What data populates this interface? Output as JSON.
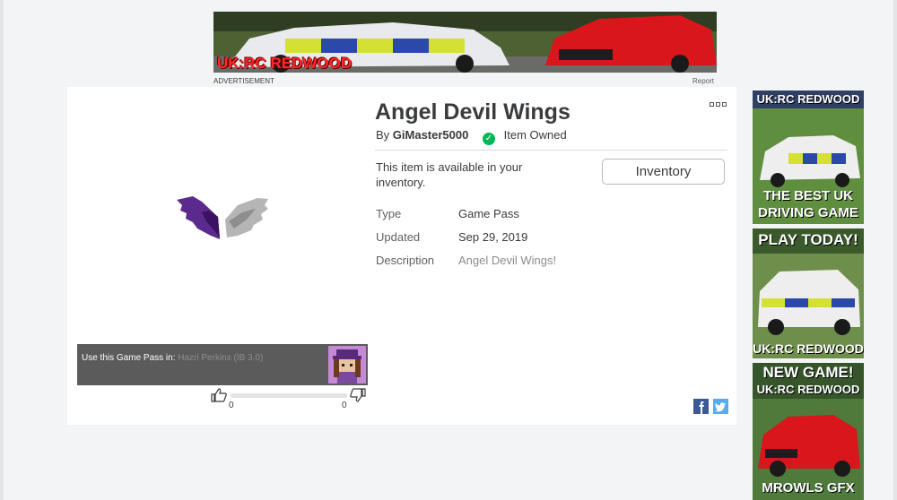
{
  "top_ad": {
    "text": "UK:RC REDWOOD",
    "caption": "ADVERTISEMENT",
    "report_label": "Report"
  },
  "item": {
    "title": "Angel Devil Wings",
    "by_prefix": "By",
    "creator": "GiMaster5000",
    "owned_label": "Item Owned",
    "availability": "This item is available in your inventory.",
    "inventory_button": "Inventory",
    "fields": [
      {
        "label": "Type",
        "value": "Game Pass"
      },
      {
        "label": "Updated",
        "value": "Sep 29, 2019"
      },
      {
        "label": "Description",
        "value": "Angel Devil Wings!"
      }
    ]
  },
  "use_in": {
    "label": "Use this Game Pass in:",
    "place": "Hazri Perkins (IB 3.0)"
  },
  "votes": {
    "up": "0",
    "down": "0"
  },
  "side_ads": [
    {
      "top": "UK:RC REDWOOD",
      "bottom": "THE BEST UK DRIVING GAME"
    },
    {
      "top": "PLAY TODAY!",
      "bottom": "UK:RC REDWOOD"
    },
    {
      "top": "NEW GAME!",
      "sub": "UK:RC REDWOOD",
      "bottom": "MROWLS GFX"
    }
  ],
  "colors": {
    "owned_green": "#02b757",
    "facebook": "#3b5998",
    "twitter": "#55acee"
  },
  "icons": [
    "more-options-icon",
    "checkmark-icon",
    "thumbs-up-icon",
    "thumbs-down-icon",
    "facebook-icon",
    "twitter-icon"
  ]
}
